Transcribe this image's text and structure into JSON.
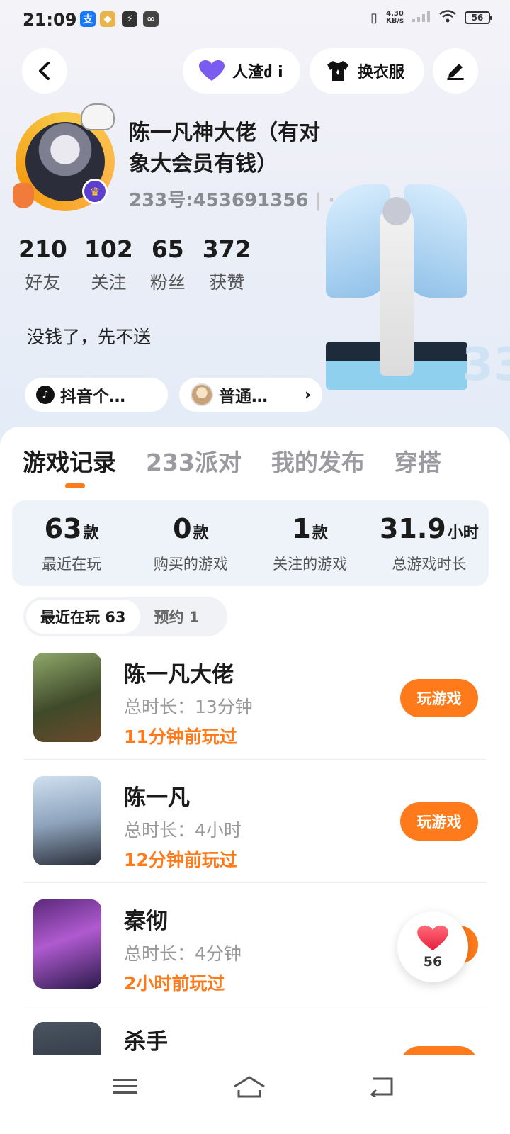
{
  "status_bar": {
    "time": "21:09",
    "net_speed_value": "4.30",
    "net_speed_unit": "KB/s",
    "battery": "56",
    "apps": [
      "alipay-icon",
      "game-icon",
      "bolt-icon",
      "link-icon"
    ]
  },
  "header": {
    "back_icon": "chevron-left-icon",
    "persona_label": "人渣ძ i",
    "outfit_label": "换衣服",
    "edit_icon": "pen-icon"
  },
  "profile": {
    "username": "陈一凡神大佬（有对象大会员有钱）",
    "id_text": "233号:453691356",
    "bio": "没钱了，先不送",
    "stats": [
      {
        "value": "210",
        "label": "好友"
      },
      {
        "value": "102",
        "label": "关注"
      },
      {
        "value": "65",
        "label": "粉丝"
      },
      {
        "value": "372",
        "label": "获赞"
      }
    ],
    "tags": [
      {
        "label": "抖音个…",
        "icon": "tiktok-icon"
      },
      {
        "label": "普通…",
        "icon": "avatar-icon"
      }
    ],
    "figure_badge": "33"
  },
  "tabs": [
    {
      "label": "游戏记录",
      "active": true
    },
    {
      "label": "233派对",
      "active": false
    },
    {
      "label": "我的发布",
      "active": false
    },
    {
      "label": "穿搭",
      "active": false
    }
  ],
  "summary": [
    {
      "value": "63",
      "unit": "款",
      "label": "最近在玩"
    },
    {
      "value": "0",
      "unit": "款",
      "label": "购买的游戏"
    },
    {
      "value": "1",
      "unit": "款",
      "label": "关注的游戏"
    },
    {
      "value": "31.9",
      "unit": "小时",
      "label": "总游戏时长"
    }
  ],
  "subtabs": [
    {
      "label": "最近在玩 63",
      "active": true
    },
    {
      "label": "预约 1",
      "active": false
    }
  ],
  "games": [
    {
      "title": "陈一凡大佬",
      "duration": "总时长：13分钟",
      "last_played": "11分钟前玩过",
      "button": "玩游戏"
    },
    {
      "title": "陈一凡",
      "duration": "总时长：4小时",
      "last_played": "12分钟前玩过",
      "button": "玩游戏"
    },
    {
      "title": "秦彻",
      "duration": "总时长：4分钟",
      "last_played": "2小时前玩过",
      "button": "玩游戏"
    },
    {
      "title": "杀手",
      "duration": "",
      "last_played": "",
      "button": ""
    }
  ],
  "like_float": {
    "count": "56",
    "icon": "heart-icon"
  },
  "colors": {
    "accent": "#ff7a1a",
    "heart": "#ff3b4f",
    "persona_heart": "#7b5cf0"
  }
}
